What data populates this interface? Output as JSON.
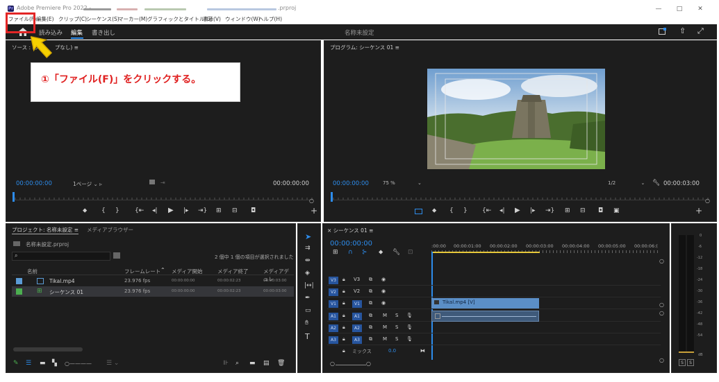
{
  "titlebar": {
    "app_icon": "Pr",
    "title": "Adobe Premiere Pro 2022 - ",
    "title_suffix": ".prproj",
    "minimize": "—",
    "maximize": "□",
    "close": "✕"
  },
  "menu": [
    "ファイル(F)",
    "編集(E)",
    "クリップ(C)",
    "シーケンス(S)",
    "マーカー(M)",
    "グラフィックとタイトル(G)",
    "表示(V)",
    "ウィンドウ(W)",
    "ヘルプ(H)"
  ],
  "workspace": {
    "tabs": [
      "読み込み",
      "編集",
      "書き出し"
    ],
    "active_tab": "編集",
    "doc_title": "名称未設定"
  },
  "source": {
    "title": "ソース : (ク",
    "title_tail": "プなし)",
    "timecode_left": "00:00:00:00",
    "page": "1ページ",
    "timecode_right": "00:00:00:00"
  },
  "program": {
    "title": "プログラム: シーケンス 01",
    "timecode_left": "00:00:00:00",
    "zoom": "75 %",
    "fraction": "1/2",
    "timecode_right": "00:00:03:00"
  },
  "project": {
    "tab_project": "プロジェクト: 名称未設定",
    "tab_media": "メディアブラウザー",
    "file": "名称未設定.prproj",
    "selection_info": "2 個中 1 個の項目が選択されました",
    "columns": [
      "名前",
      "フレームレート",
      "メディア開始",
      "メディア終了",
      "メディアデュレ"
    ],
    "rows": [
      {
        "name": "Tikal.mp4",
        "fps": "23.976 fps",
        "start": "00:00:00:00",
        "end": "00:00:02:23",
        "dur": "00:00:03:00",
        "color": "#5b9bd5"
      },
      {
        "name": "シーケンス 01",
        "fps": "23.976 fps",
        "start": "00:00:00:00",
        "end": "00:00:02:23",
        "dur": "00:00:03:00",
        "color": "#4caf50"
      }
    ]
  },
  "timeline": {
    "tab": "シーケンス 01",
    "timecode": "00:00:00:00",
    "ruler": [
      ":00:00",
      "00:00:01:00",
      "00:00:02:00",
      "00:00:03:00",
      "00:00:04:00",
      "00:00:05:00",
      "00:00:06:("
    ],
    "video_tracks": [
      "V3",
      "V2",
      "V1"
    ],
    "audio_tracks": [
      "A1",
      "A2",
      "A3"
    ],
    "clip_label": "Tikal.mp4 [V]",
    "mix_label": "ミックス",
    "mix_value": "0.0"
  },
  "meter": {
    "ticks": [
      "0",
      "-6",
      "-12",
      "-18",
      "-24",
      "-30",
      "-36",
      "-42",
      "-48",
      "-54",
      "dB"
    ],
    "solo": [
      "S",
      "S"
    ]
  },
  "annotation": {
    "text": "①「ファイル(F)」をクリックする。"
  },
  "colors": {
    "accent": "#2d8ceb",
    "clip": "#5b8fc7",
    "annotation_red": "#e32626",
    "arrow_yellow": "#f5d000"
  }
}
